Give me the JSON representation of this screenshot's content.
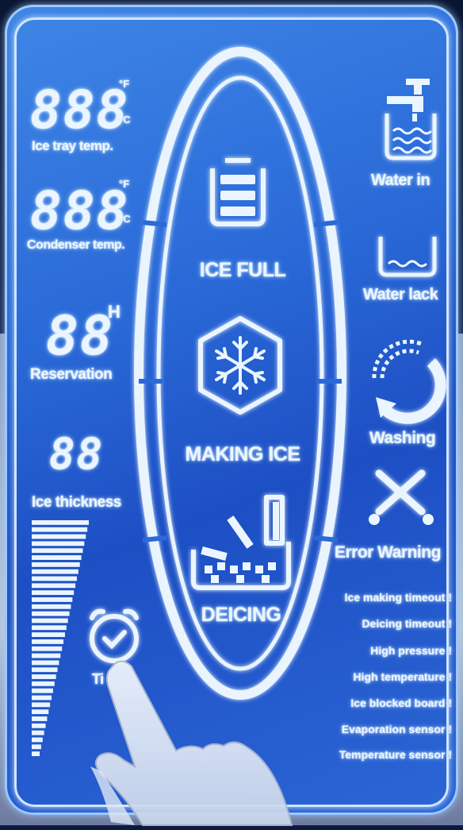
{
  "left": {
    "ice_tray": {
      "digits": "888",
      "unit_f": "°F",
      "unit_c": "°C",
      "label": "Ice tray temp."
    },
    "condenser": {
      "digits": "888",
      "unit_f": "°F",
      "unit_c": "°C",
      "label": "Condenser temp."
    },
    "reservation": {
      "digits": "88",
      "unit": "H",
      "label": "Reservation"
    },
    "ice_thickness": {
      "digits": "88",
      "label": "Ice thickness"
    },
    "timer": {
      "label": "Ti"
    }
  },
  "center": {
    "ice_full": "ICE FULL",
    "making_ice": "MAKING ICE",
    "deicing": "DEICING"
  },
  "right": {
    "water_in": "Water in",
    "water_lack": "Water lack",
    "washing": "Washing",
    "error_warning": "Error Warning",
    "errors": [
      "Ice making timeout !",
      "Deicing timeout !",
      "High pressure !",
      "High temperature !",
      "Ice blocked board !",
      "Evaporation sensor !",
      "Temperature sensor !"
    ]
  },
  "colors": {
    "panel": "#2a6ad8",
    "glow": "#eaf5ff",
    "line": "#cfe6ff"
  }
}
